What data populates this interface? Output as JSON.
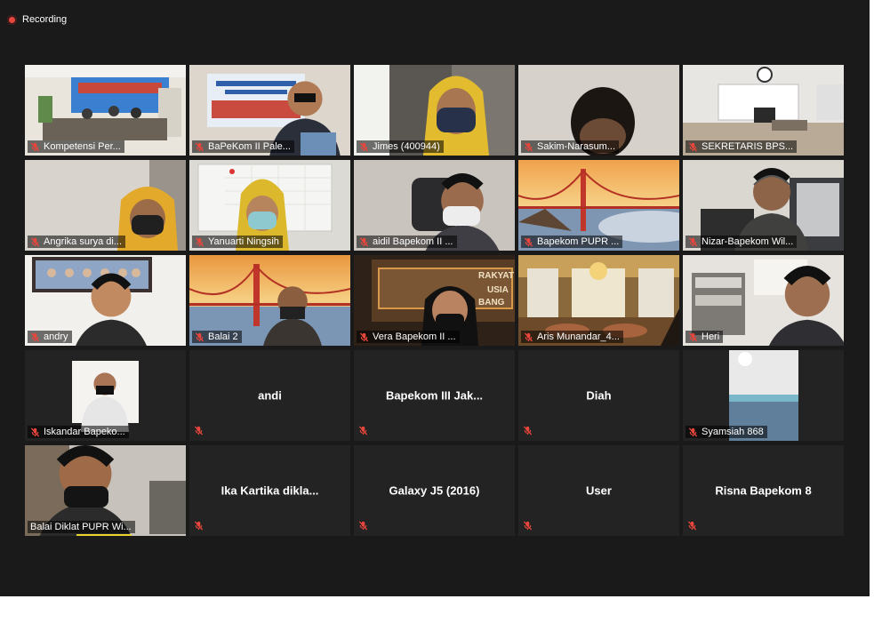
{
  "recording": {
    "label": "Recording"
  },
  "colors": {
    "app_bg": "#1a1a1a",
    "tile_bg": "#232323",
    "active_border": "#b8d44a",
    "record": "#e8463c",
    "mute_icon": "#e8463c"
  },
  "participants": [
    {
      "name": "Kompetensi Per...",
      "video": true,
      "scene": "meeting-room"
    },
    {
      "name": "BaPeKom II Pale...",
      "video": true,
      "scene": "man-banner"
    },
    {
      "name": "Jimes (400944)",
      "video": true,
      "scene": "woman-yellow"
    },
    {
      "name": "Sakim-Narasum...",
      "video": true,
      "scene": "man-dark"
    },
    {
      "name": "SEKRETARIS BPS...",
      "video": true,
      "scene": "office"
    },
    {
      "name": "Angrika surya di...",
      "video": true,
      "scene": "woman-hijab"
    },
    {
      "name": "Yanuarti Ningsih",
      "video": true,
      "scene": "woman-whiteboard"
    },
    {
      "name": "aidil Bapekom II ...",
      "video": true,
      "scene": "man-mask"
    },
    {
      "name": "Bapekom PUPR ...",
      "video": true,
      "scene": "bridge"
    },
    {
      "name": "Nizar-Bapekom Wil...",
      "video": true,
      "scene": "man-office",
      "active": true
    },
    {
      "name": "andry",
      "video": true,
      "scene": "man-photo"
    },
    {
      "name": "Balai 2",
      "video": true,
      "scene": "bridge-man"
    },
    {
      "name": "Vera Bapekom II ...",
      "video": true,
      "scene": "woman-sign"
    },
    {
      "name": "Aris Munandar_4...",
      "video": true,
      "scene": "palace"
    },
    {
      "name": "Heri",
      "video": true,
      "scene": "man-shelf"
    },
    {
      "name": "Iskandar Bapeko...",
      "video": true,
      "scene": "small-portrait"
    },
    {
      "name": "andi",
      "video": false
    },
    {
      "name": "Bapekom III Jak...",
      "video": false
    },
    {
      "name": "Diah",
      "video": false
    },
    {
      "name": "Syamsiah 868",
      "video": true,
      "scene": "room-blue"
    },
    {
      "name": "Balai Diklat PUPR Wi...",
      "video": true,
      "scene": "man-closeup",
      "no_mute": true
    },
    {
      "name": "Ika Kartika dikla...",
      "video": false
    },
    {
      "name": "Galaxy J5 (2016)",
      "video": false
    },
    {
      "name": "User",
      "video": false
    },
    {
      "name": "Risna Bapekom 8",
      "video": false
    }
  ]
}
